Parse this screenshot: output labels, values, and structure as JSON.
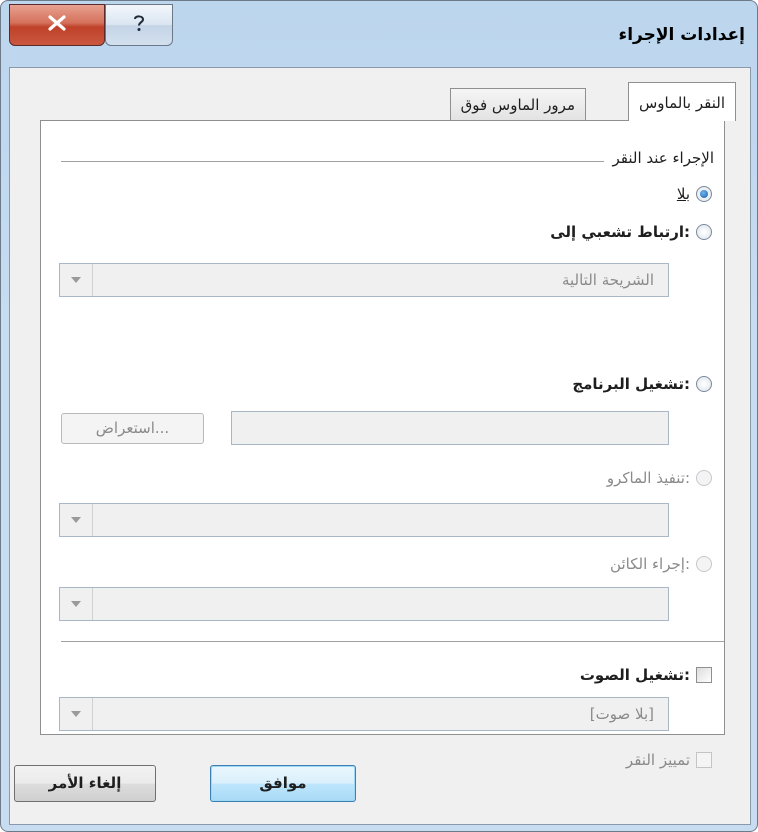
{
  "window": {
    "title": "إعدادات الإجراء"
  },
  "titlebar": {
    "close_icon": "close-icon",
    "help_icon": "question-mark-icon",
    "close_color": "#c7442d"
  },
  "tabs": [
    {
      "label": "النقر بالماوس",
      "selected": true
    },
    {
      "label": "مرور الماوس فوق",
      "selected": false
    }
  ],
  "group": {
    "title": "الإجراء عند النقر"
  },
  "options": {
    "none": {
      "label": "بلا",
      "selected": true,
      "enabled": true
    },
    "hyperlink": {
      "label": "ارتباط تشعبي إلى:",
      "selected": false,
      "enabled": true
    },
    "run_program": {
      "label": "تشغيل البرنامج:",
      "selected": false,
      "enabled": true
    },
    "run_macro": {
      "label": "تنفيذ الماكرو:",
      "selected": false,
      "enabled": false
    },
    "object_action": {
      "label": "إجراء الكائن:",
      "selected": false,
      "enabled": false
    }
  },
  "hyperlink_combo": {
    "value": "الشريحة التالية"
  },
  "program_input": {
    "value": ""
  },
  "browse_button": {
    "label": "استعراض..."
  },
  "macro_combo": {
    "value": ""
  },
  "object_combo": {
    "value": ""
  },
  "play_sound": {
    "label": "تشغيل الصوت:",
    "checked": false
  },
  "sound_combo": {
    "value": "[بلا صوت]"
  },
  "highlight_click": {
    "label": "تمييز النقر",
    "checked": false,
    "enabled": false
  },
  "buttons": {
    "ok": "موافق",
    "cancel": "إلغاء الأمر"
  },
  "colors": {
    "accent": "#1c5ea8",
    "default_button_border": "#3c7fb1"
  }
}
